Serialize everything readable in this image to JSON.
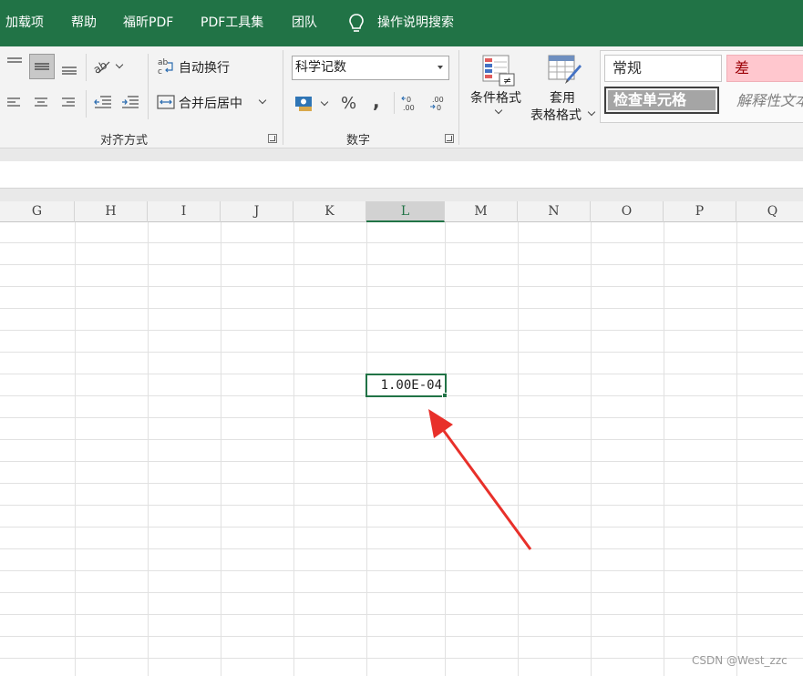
{
  "menu": {
    "items": [
      "加载项",
      "帮助",
      "福昕PDF",
      "PDF工具集",
      "团队"
    ],
    "tell_me": "操作说明搜索"
  },
  "ribbon": {
    "alignment": {
      "wrap_text": "自动换行",
      "merge_center": "合并后居中",
      "group_label": "对齐方式"
    },
    "number": {
      "format_value": "科学记数",
      "percent": "%",
      "comma": ",",
      "group_label": "数字"
    },
    "styles": {
      "conditional_formatting": "条件格式",
      "format_as_table_line1": "套用",
      "format_as_table_line2": "表格格式",
      "style_normal": "常规",
      "style_bad": "差",
      "style_check_cell": "检查单元格",
      "style_explanatory": "解释性文本"
    }
  },
  "columns": [
    "G",
    "H",
    "I",
    "J",
    "K",
    "L",
    "M",
    "N",
    "O",
    "P",
    "Q"
  ],
  "selected_column": "L",
  "active_cell": {
    "value": "1.00E-04"
  },
  "colors": {
    "accent": "#217346",
    "arrow": "#e8302a",
    "bad_fill": "#ffc7ce",
    "check_fill": "#a5a5a5"
  },
  "watermark": "CSDN @West_zzc"
}
